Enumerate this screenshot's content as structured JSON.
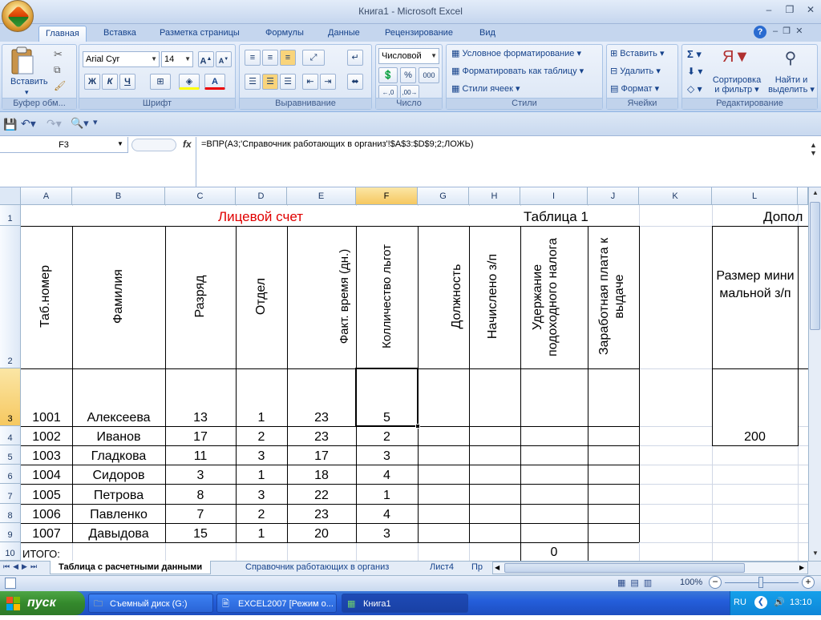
{
  "window": {
    "title": "Книга1 - Microsoft Excel",
    "minimize": "–",
    "restore": "❐",
    "close": "✕"
  },
  "ribbon_tabs": [
    "Главная",
    "Вставка",
    "Разметка страницы",
    "Формулы",
    "Данные",
    "Рецензирование",
    "Вид"
  ],
  "ribbon": {
    "clipboard": {
      "label": "Буфер обм...",
      "paste": "Вставить"
    },
    "font": {
      "label": "Шрифт",
      "name": "Arial Cyr",
      "size": "14",
      "bold": "Ж",
      "italic": "К",
      "underline": "Ч"
    },
    "alignment": {
      "label": "Выравнивание"
    },
    "number": {
      "label": "Число",
      "format": "Числовой",
      "percent": "%",
      "thousands": "000"
    },
    "styles": {
      "label": "Стили",
      "conditional": "Условное форматирование",
      "table": "Форматировать как таблицу",
      "cell_styles": "Стили ячеек"
    },
    "cells": {
      "label": "Ячейки",
      "insert": "Вставить",
      "delete": "Удалить",
      "format": "Формат"
    },
    "editing": {
      "label": "Редактирование",
      "sort": "Сортировка",
      "sort2": "и фильтр",
      "find": "Найти и",
      "find2": "выделить"
    }
  },
  "formula_bar": {
    "name_box": "F3",
    "fx": "fx",
    "formula": "=ВПР(A3;'Справочник работающих в организ'!$A$3:$D$9;2;ЛОЖЬ)"
  },
  "columns": [
    "A",
    "B",
    "C",
    "D",
    "E",
    "F",
    "G",
    "H",
    "I",
    "J",
    "K",
    "L"
  ],
  "rows": [
    "1",
    "2",
    "3",
    "4",
    "5",
    "6",
    "7",
    "8",
    "9",
    "10"
  ],
  "sheet": {
    "title": "Лицевой счет",
    "table_label": "Таблица 1",
    "extra_label": "Допол",
    "headers": [
      "Таб.номер",
      "Фамилия",
      "Разряд",
      "Отдел",
      "Факт. время (дн.)",
      "Колличество льгот",
      "Должность",
      "Начислено з/п",
      "Удержание подоходного налога",
      "Заработная плата к выдаче"
    ],
    "min_wage_header": "Размер минимальной з/п",
    "min_wage_value": "200",
    "data_rows": [
      [
        "1001",
        "Алексеева",
        "13",
        "1",
        "23",
        "5"
      ],
      [
        "1002",
        "Иванов",
        "17",
        "2",
        "23",
        "2"
      ],
      [
        "1003",
        "Гладкова",
        "11",
        "3",
        "17",
        "3"
      ],
      [
        "1004",
        "Сидоров",
        "3",
        "1",
        "18",
        "4"
      ],
      [
        "1005",
        "Петрова",
        "8",
        "3",
        "22",
        "1"
      ],
      [
        "1006",
        "Павленко",
        "7",
        "2",
        "23",
        "4"
      ],
      [
        "1007",
        "Давыдова",
        "15",
        "1",
        "20",
        "3"
      ]
    ],
    "total_label": "ИТОГО:",
    "total_value": "0"
  },
  "sheet_tabs": [
    "Таблица с расчетными данными",
    "Справочник работающих в организ",
    "Лист4",
    "Пр"
  ],
  "status": {
    "zoom": "100%"
  },
  "taskbar": {
    "start": "пуск",
    "tasks": [
      "Съемный диск (G:)",
      "EXCEL2007 [Режим о...",
      "Книга1"
    ],
    "lang": "RU",
    "time": "13:10"
  }
}
